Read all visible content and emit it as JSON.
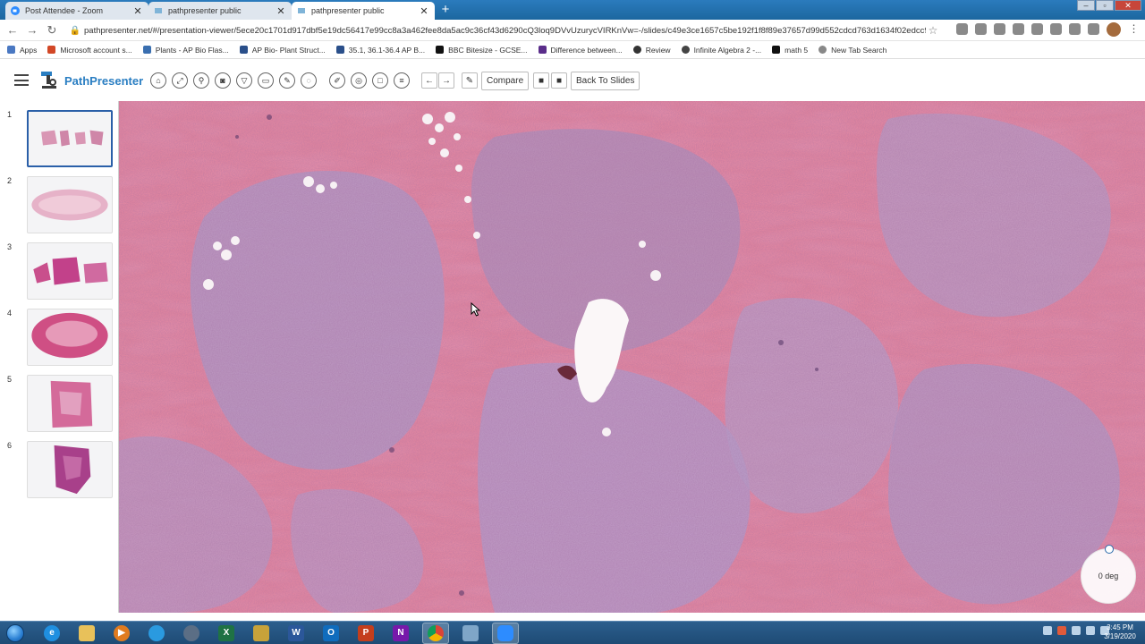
{
  "browser": {
    "tabs": [
      {
        "title": "Post Attendee - Zoom",
        "active": false
      },
      {
        "title": "pathpresenter public",
        "active": false
      },
      {
        "title": "pathpresenter public",
        "active": true
      }
    ],
    "new_tab_label": "+",
    "url": "pathpresenter.net/#/presentation-viewer/5ece20c1701d917dbf5e19dc56417e99cc8a3a462fee8da5ac9c36cf43d6290cQ3loq9DVvUzurycVIRKnVw=-/slides/c49e3ce1657c5be192f1f8f89e37657d99d552cdcd763d1634f02edcc9...",
    "bookmarks": [
      {
        "label": "Apps",
        "color": "#4a78c2"
      },
      {
        "label": "Microsoft account s...",
        "color": "#d24726"
      },
      {
        "label": "Plants - AP Bio Flas...",
        "color": "#3a6fb0"
      },
      {
        "label": "AP Bio- Plant Struct...",
        "color": "#2a4f8a"
      },
      {
        "label": "35.1, 36.1-36.4 AP B...",
        "color": "#2a4f8a"
      },
      {
        "label": "BBC Bitesize - GCSE...",
        "color": "#111111"
      },
      {
        "label": "Difference between...",
        "color": "#5a2d8a"
      },
      {
        "label": "Review",
        "color": "#333333"
      },
      {
        "label": "Infinite Algebra 2 -...",
        "color": "#444444"
      },
      {
        "label": "math 5",
        "color": "#111111"
      },
      {
        "label": "New Tab Search",
        "color": "#888888"
      }
    ]
  },
  "app": {
    "name": "PathPresenter",
    "toolbar": {
      "compare_label": "Compare",
      "back_label": "Back To Slides"
    },
    "slides": [
      {
        "num": "1",
        "selected": true
      },
      {
        "num": "2",
        "selected": false
      },
      {
        "num": "3",
        "selected": false
      },
      {
        "num": "4",
        "selected": false
      },
      {
        "num": "5",
        "selected": false
      },
      {
        "num": "6",
        "selected": false
      }
    ],
    "rotation_label": "0 deg"
  },
  "taskbar": {
    "time": "3:45 PM",
    "date": "3/19/2020"
  },
  "colors": {
    "accent": "#2a7ec2",
    "tissue_pink": "#e88aa0",
    "tissue_purple": "#b99ac8"
  }
}
